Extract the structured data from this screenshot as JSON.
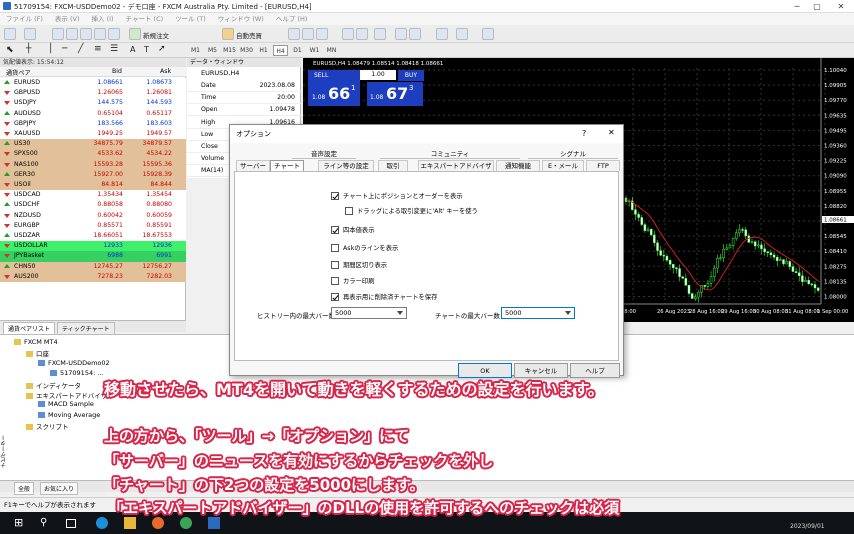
{
  "window": {
    "title": "51709154: FXCM-USDDemo02 - デモ口座 - FXCM Australia Pty. Limited - [EURUSD,H4]"
  },
  "menu": [
    "ファイル (F)",
    "表示 (V)",
    "挿入 (I)",
    "チャート (C)",
    "ツール (T)",
    "ウィンドウ (W)",
    "ヘルプ (H)"
  ],
  "toolbar": {
    "new_order": "新規注文",
    "auto_trade": "自動売買",
    "timeframes": [
      "M1",
      "M5",
      "M15",
      "M30",
      "H1",
      "H4",
      "D1",
      "W1",
      "MN"
    ]
  },
  "market_watch": {
    "header": "気配値表示: 15:54:12",
    "columns": {
      "symbol": "通貨ペア",
      "bid": "Bid",
      "ask": "Ask"
    },
    "rows": [
      {
        "symbol": "EURUSD",
        "bid": "1.08661",
        "ask": "1.08673",
        "group": "fx"
      },
      {
        "symbol": "GBPUSD",
        "bid": "1.26065",
        "ask": "1.26081",
        "group": "fx"
      },
      {
        "symbol": "USDJPY",
        "bid": "144.575",
        "ask": "144.593",
        "group": "fx"
      },
      {
        "symbol": "AUDUSD",
        "bid": "0.65104",
        "ask": "0.65117",
        "group": "fx"
      },
      {
        "symbol": "GBPJPY",
        "bid": "183.566",
        "ask": "183.603",
        "group": "fx"
      },
      {
        "symbol": "XAUUSD",
        "bid": "1949.25",
        "ask": "1949.57",
        "group": "fx"
      },
      {
        "symbol": "US30",
        "bid": "34875.79",
        "ask": "34879.57",
        "group": "idx"
      },
      {
        "symbol": "SPX500",
        "bid": "4533.62",
        "ask": "4534.22",
        "group": "idx"
      },
      {
        "symbol": "NAS100",
        "bid": "15593.28",
        "ask": "15595.36",
        "group": "idx"
      },
      {
        "symbol": "GER30",
        "bid": "15927.00",
        "ask": "15928.39",
        "group": "idx"
      },
      {
        "symbol": "USOil",
        "bid": "84.814",
        "ask": "84.844",
        "group": "idx"
      },
      {
        "symbol": "USDCAD",
        "bid": "1.35434",
        "ask": "1.35454",
        "group": "usd"
      },
      {
        "symbol": "USDCHF",
        "bid": "0.88058",
        "ask": "0.88080",
        "group": "usd"
      },
      {
        "symbol": "NZDUSD",
        "bid": "0.60042",
        "ask": "0.60059",
        "group": "usd"
      },
      {
        "symbol": "EURGBP",
        "bid": "0.85571",
        "ask": "0.85591",
        "group": "usd"
      },
      {
        "symbol": "USDZAR",
        "bid": "18.66051",
        "ask": "18.67553",
        "group": "usd"
      },
      {
        "symbol": "USDOLLAR",
        "bid": "12933",
        "ask": "12936",
        "group": "basket"
      },
      {
        "symbol": "JPYBasket",
        "bid": "6988",
        "ask": "6991",
        "group": "basket"
      },
      {
        "symbol": "CHN50",
        "bid": "12745.27",
        "ask": "12756.27",
        "group": "idx"
      },
      {
        "symbol": "AUS200",
        "bid": "7278.23",
        "ask": "7282.03",
        "group": "idx"
      }
    ],
    "tabs": [
      "通貨ペアリスト",
      "ティックチャート"
    ]
  },
  "data_window": {
    "header": "データ・ウィンドウ",
    "symbol": "EURUSD,H4",
    "rows": [
      {
        "key": "Date",
        "value": "2023.08.08"
      },
      {
        "key": "Time",
        "value": "20:00"
      },
      {
        "key": "Open",
        "value": "1.09478"
      },
      {
        "key": "High",
        "value": "1.09616"
      },
      {
        "key": "Low",
        "value": ""
      },
      {
        "key": "Close",
        "value": ""
      },
      {
        "key": "Volume",
        "value": ""
      },
      {
        "key": "MA(14)",
        "value": ""
      }
    ]
  },
  "chart": {
    "header": "EURUSD,H4  1.08479 1.08514 1.08418 1.08661",
    "sell_label": "SELL",
    "buy_label": "BUY",
    "lot": "1.00",
    "sell_price": {
      "prefix": "1.08",
      "big": "66",
      "sup": "1"
    },
    "buy_price": {
      "prefix": "1.08",
      "big": "67",
      "sup": "3"
    },
    "price_labels": [
      "1.10040",
      "1.09905",
      "1.09770",
      "1.09635",
      "1.09495",
      "1.09360",
      "1.09225",
      "1.09090",
      "1.08955",
      "1.08820",
      "1.08661",
      "1.08545",
      "1.08410",
      "1.08275",
      "1.08135",
      "1.08000"
    ],
    "date_labels": [
      "26 Aug 2023",
      "28 Aug 16:00",
      "29 Aug 16:00",
      "30 Aug 08:00",
      "31 Aug 08:00",
      "1 Sep 00:00"
    ],
    "date_labels_left": [
      "08:00"
    ],
    "current_price": "1.08661"
  },
  "navigator": {
    "items": [
      {
        "label": "FXCM MT4",
        "level": 0
      },
      {
        "label": "口座",
        "level": 1
      },
      {
        "label": "FXCM-USDDemo02",
        "level": 2
      },
      {
        "label": "51709154: ...",
        "level": 3
      },
      {
        "label": "インディケータ",
        "level": 1
      },
      {
        "label": "エキスパートアドバイザ",
        "level": 1
      },
      {
        "label": "MACD Sample",
        "level": 2
      },
      {
        "label": "Moving Average",
        "level": 2
      },
      {
        "label": "スクリプト",
        "level": 1
      }
    ],
    "side_label": "ナビゲーター",
    "tabs": [
      "全般",
      "お気に入り"
    ]
  },
  "status_bar": "F1キーでヘルプが表示されます",
  "taskbar": {
    "clock": "2023/09/01"
  },
  "dialog": {
    "title": "オプション",
    "help": "?",
    "close": "✕",
    "tab_groups": [
      "音声設定",
      "コミュニティ",
      "シグナル"
    ],
    "tabs": [
      "サーバー",
      "チャート",
      "ライン等の設定",
      "取引",
      "エキスパートアドバイザ",
      "通知機能",
      "E・メール",
      "FTP"
    ],
    "selected_tab": "チャート",
    "checkboxes": [
      {
        "label": "チャート上にポジションとオーダーを表示",
        "checked": true
      },
      {
        "label": "ドラッグによる取引変更に'Alt' キーを使う",
        "checked": false
      },
      {
        "label": "四本値表示",
        "checked": true
      },
      {
        "label": "Askのラインを表示",
        "checked": false
      },
      {
        "label": "期間区切り表示",
        "checked": false
      },
      {
        "label": "カラー印刷",
        "checked": false
      },
      {
        "label": "再表示用に削除済チャートを保存",
        "checked": true
      }
    ],
    "history_label": "ヒストリー内の最大バー数",
    "history_value": "5000",
    "chart_label": "チャートの最大バー数 :",
    "chart_value": "5000",
    "ok": "OK",
    "cancel": "キャンセル",
    "help_btn": "ヘルプ"
  },
  "captions": {
    "line1": "移動させたら、MT4を開いて動きを軽くするための設定を行います。",
    "line2": "上の方から、「ツール」→「オプション」にて",
    "line3": "「サーバー」のニュースを有効にするからチェックを外し",
    "line4": "「チャート」の下2つの設定を5000にします。",
    "line5": "「エキスパートアドバイザー」のDLLの使用を許可するへのチェックは必須"
  }
}
